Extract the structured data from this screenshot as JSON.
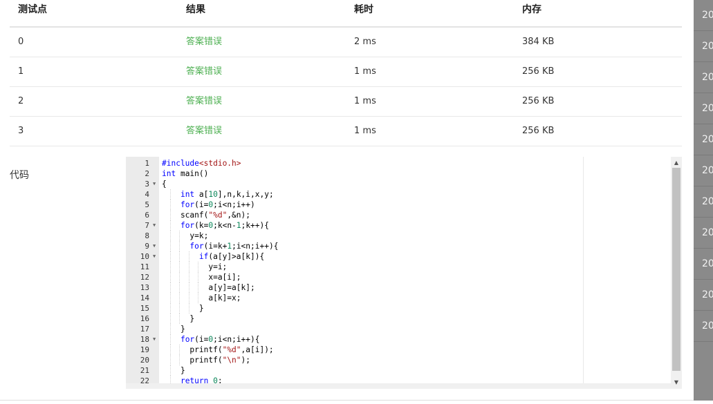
{
  "results": {
    "headers": [
      "测试点",
      "结果",
      "耗时",
      "内存"
    ],
    "rows": [
      {
        "id": "0",
        "status": "答案错误",
        "time": "2 ms",
        "memory": "384 KB"
      },
      {
        "id": "1",
        "status": "答案错误",
        "time": "1 ms",
        "memory": "256 KB"
      },
      {
        "id": "2",
        "status": "答案错误",
        "time": "1 ms",
        "memory": "256 KB"
      },
      {
        "id": "3",
        "status": "答案错误",
        "time": "1 ms",
        "memory": "256 KB"
      }
    ],
    "status_color": "#4caf50"
  },
  "code_section": {
    "label": "代码",
    "lines": [
      {
        "n": "1",
        "t": "#include<stdio.h>",
        "fold": false
      },
      {
        "n": "2",
        "t": "int main()",
        "fold": false
      },
      {
        "n": "3",
        "t": "{",
        "fold": true
      },
      {
        "n": "4",
        "t": "    int a[10],n,k,i,x,y;",
        "fold": false
      },
      {
        "n": "5",
        "t": "    for(i=0;i<n;i++)",
        "fold": false
      },
      {
        "n": "6",
        "t": "    scanf(\"%d\",&n);",
        "fold": false
      },
      {
        "n": "7",
        "t": "    for(k=0;k<n-1;k++){",
        "fold": true
      },
      {
        "n": "8",
        "t": "      y=k;",
        "fold": false
      },
      {
        "n": "9",
        "t": "      for(i=k+1;i<n;i++){",
        "fold": true
      },
      {
        "n": "10",
        "t": "        if(a[y]>a[k]){",
        "fold": true
      },
      {
        "n": "11",
        "t": "          y=i;",
        "fold": false
      },
      {
        "n": "12",
        "t": "          x=a[i];",
        "fold": false
      },
      {
        "n": "13",
        "t": "          a[y]=a[k];",
        "fold": false
      },
      {
        "n": "14",
        "t": "          a[k]=x;",
        "fold": false
      },
      {
        "n": "15",
        "t": "        }",
        "fold": false
      },
      {
        "n": "16",
        "t": "      }",
        "fold": false
      },
      {
        "n": "17",
        "t": "    }",
        "fold": false
      },
      {
        "n": "18",
        "t": "    for(i=0;i<n;i++){",
        "fold": true
      },
      {
        "n": "19",
        "t": "      printf(\"%d\",a[i]);",
        "fold": false
      },
      {
        "n": "20",
        "t": "      printf(\"\\n\");",
        "fold": false
      },
      {
        "n": "21",
        "t": "    }",
        "fold": false
      },
      {
        "n": "22",
        "t": "    return 0;",
        "fold": false
      }
    ]
  },
  "side_panel": {
    "items": [
      "20",
      "20",
      "20",
      "20",
      "20",
      "20",
      "20",
      "20",
      "20",
      "20",
      "20"
    ]
  }
}
